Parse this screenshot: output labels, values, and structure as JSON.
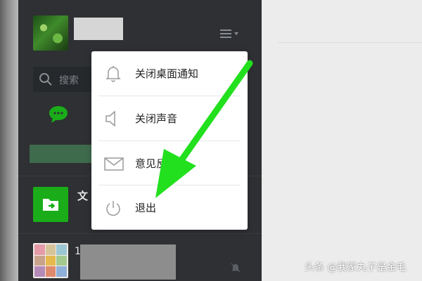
{
  "sidebar": {
    "search_placeholder": "搜索",
    "file_transfer_label": "文",
    "group_name_fragment": "1"
  },
  "menu": {
    "items": [
      {
        "label": "关闭桌面通知",
        "icon": "bell-icon"
      },
      {
        "label": "关闭声音",
        "icon": "speaker-icon"
      },
      {
        "label": "意见反",
        "icon": "envelope-icon"
      },
      {
        "label": "退出",
        "icon": "power-icon"
      }
    ]
  },
  "annotation": {
    "arrow_color": "#22e01e"
  },
  "watermark": "头条 @我家丸子是金毛",
  "colors": {
    "sidebar": "#2e3033",
    "accent": "#1aad19"
  }
}
